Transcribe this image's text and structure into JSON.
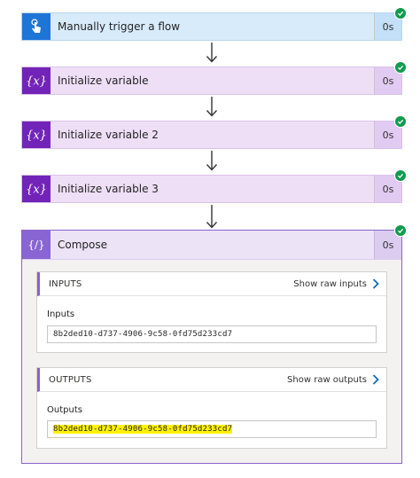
{
  "flow": {
    "steps": [
      {
        "title": "Manually trigger a flow",
        "duration": "0s",
        "icon": "touch-hand-icon",
        "status": "succeeded"
      },
      {
        "title": "Initialize variable",
        "duration": "0s",
        "icon": "variable-braces-icon",
        "status": "succeeded"
      },
      {
        "title": "Initialize variable 2",
        "duration": "0s",
        "icon": "variable-braces-icon",
        "status": "succeeded"
      },
      {
        "title": "Initialize variable 3",
        "duration": "0s",
        "icon": "variable-braces-icon",
        "status": "succeeded"
      }
    ],
    "compose": {
      "title": "Compose",
      "duration": "0s",
      "icon": "compose-braces-icon",
      "status": "succeeded",
      "inputs": {
        "section_title": "INPUTS",
        "raw_link": "Show raw inputs",
        "label": "Inputs",
        "value": "8b2ded10-d737-4906-9c58-0fd75d233cd7"
      },
      "outputs": {
        "section_title": "OUTPUTS",
        "raw_link": "Show raw outputs",
        "label": "Outputs",
        "value": "8b2ded10-d737-4906-9c58-0fd75d233cd7",
        "highlighted": true
      }
    }
  },
  "colors": {
    "trigger_accent": "#1f75d6",
    "variable_accent": "#7224b8",
    "compose_accent": "#8965d4",
    "success": "#119b4f",
    "highlight": "#fff200",
    "link_chevron": "#0f6cbd"
  }
}
